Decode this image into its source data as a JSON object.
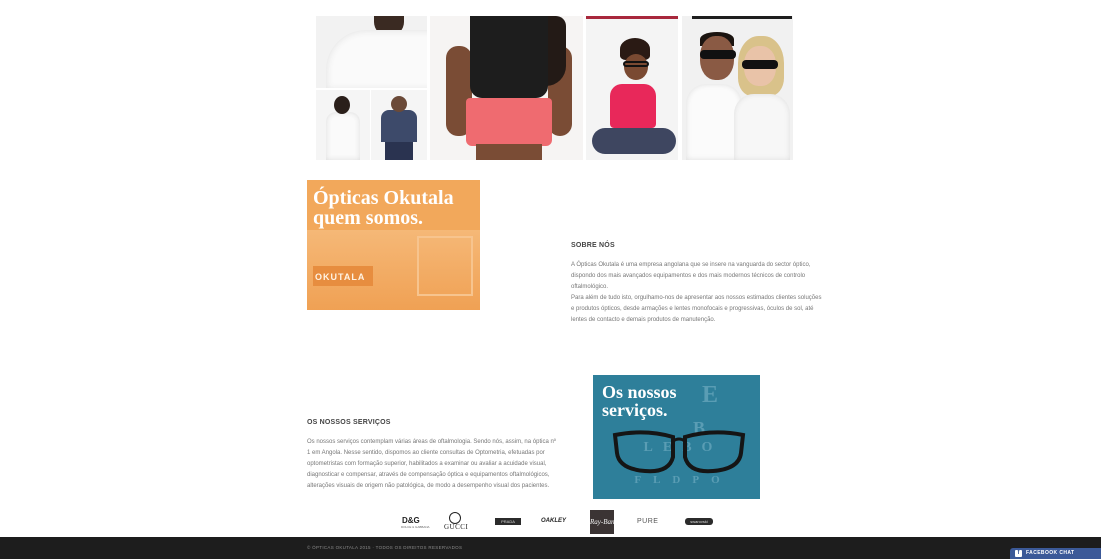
{
  "about": {
    "banner_title": "Ópticas Okutala quem somos.",
    "banner_desk_label": "OKUTALA",
    "heading": "SOBRE NÓS",
    "paragraph_1": "A Ópticas Okutala é uma empresa angolana que se insere na vanguarda do sector óptico, dispondo dos mais avançados equipamentos e dos mais modernos técnicos de controlo oftalmológico.",
    "paragraph_2": "Para além de tudo isto, orgulhamo-nos de apresentar aos nossos estimados clientes soluções e produtos ópticos, desde armações e lentes monofocais e progressivas, óculos de sol, até lentes de contacto e demais produtos de manutenção."
  },
  "services": {
    "banner_title": "Os nossos serviços.",
    "eye_chart_rows": [
      "E",
      "B",
      "LEBO",
      "FLDPO"
    ],
    "heading": "OS NOSSOS SERVIÇOS",
    "paragraph_1": "Os nossos serviços contemplam várias áreas de oftalmologia. Sendo nós, assim, na óptica nº 1 em Angola. Nesse sentido, dispomos ao cliente consultas de Optometria, efetuadas por optometristas com formação superior, habilitados a examinar ou avaliar a acuidade visual, diagnosticar e compensar, através de compensação óptica e equipamentos oftalmológicos, alterações visuais de origem não patológica, de modo a desempenho visual dos pacientes."
  },
  "brands": {
    "dg": "D&G",
    "dg_sub": "DOLCE & GABBANA",
    "gucci": "GUCCI",
    "box1": "PRADA",
    "oakley": "OAKLEY",
    "rayban": "Ray-Ban",
    "pure": "PURE",
    "box2": "swarovski"
  },
  "footer": {
    "copyright": "© ÓPTICAS OKUTALA 2015 · TODOS OS DIREITOS RESERVADOS"
  },
  "facebook_chat": {
    "icon": "f",
    "label": "FACEBOOK CHAT",
    "color": "#3b5998"
  },
  "colors": {
    "banner_orange": "#f2a85b",
    "banner_blue": "#2e7f9a",
    "footer": "#1d1d1d"
  }
}
